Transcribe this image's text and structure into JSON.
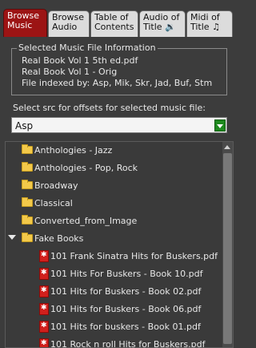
{
  "tabs": [
    {
      "line1": "Browse",
      "line2": "Music",
      "active": true
    },
    {
      "line1": "Browse",
      "line2": "Audio",
      "active": false
    },
    {
      "line1": "Table of",
      "line2": "Contents",
      "active": false
    },
    {
      "line1": "Audio of",
      "line2": "Title",
      "sym": "🔉",
      "active": false
    },
    {
      "line1": "Midi of",
      "line2": "Title",
      "sym": "♫",
      "active": false
    }
  ],
  "file_info": {
    "legend": "Selected Music File Information",
    "lines": [
      "Real Book Vol 1 5th ed.pdf",
      "Real Book Vol 1 - Orig",
      "File indexed by: Asp, Mik, Skr, Jad, Buf, Stm"
    ]
  },
  "offsets": {
    "label": "Select src for offsets for selected music file:",
    "selected": "Asp"
  },
  "tree": {
    "folders": [
      "Anthologies - Jazz",
      "Anthologies - Pop, Rock",
      "Broadway",
      "Classical",
      "Converted_from_Image",
      "Fake Books"
    ],
    "files": [
      "101 Frank Sinatra Hits for Buskers.pdf",
      "101 Hits For Buskers - Book 10.pdf",
      "101 Hits for Buskers - Book 02.pdf",
      "101 Hits for Buskers - Book 06.pdf",
      "101 Hits for buskers - Book 01.pdf",
      "101 Rock n roll Hits for Buskers.pdf"
    ]
  },
  "colors": {
    "active_tab": "#9c1414",
    "folder": "#f3c94a",
    "pdf": "#d0201c",
    "combo_button": "#1e8a1e"
  }
}
